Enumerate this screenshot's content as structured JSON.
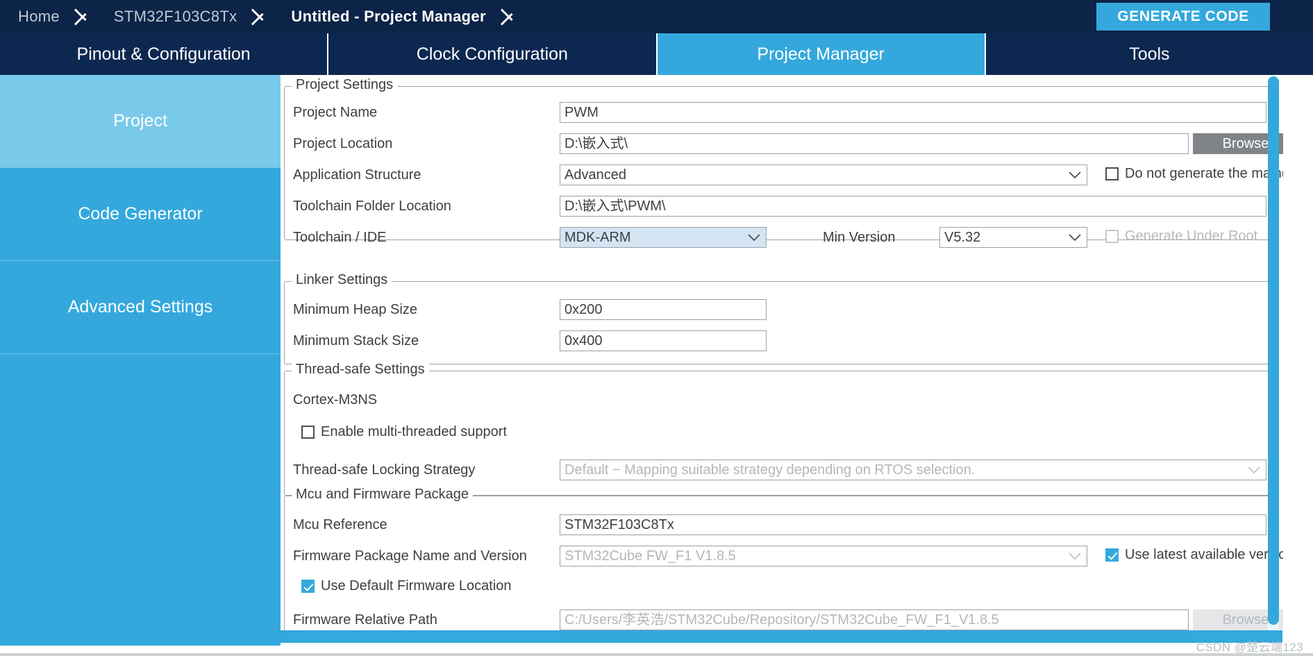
{
  "topbar": {
    "breadcrumbs": [
      {
        "label": "Home",
        "active": false
      },
      {
        "label": "STM32F103C8Tx",
        "active": false
      },
      {
        "label": "Untitled - Project Manager",
        "active": true
      }
    ],
    "generate_code_label": "GENERATE CODE",
    "accent_color": "#34a8dd",
    "bar_color": "#0b2447"
  },
  "tabs": [
    {
      "label": "Pinout & Configuration",
      "active": false
    },
    {
      "label": "Clock Configuration",
      "active": false
    },
    {
      "label": "Project Manager",
      "active": true
    },
    {
      "label": "Tools",
      "active": false
    }
  ],
  "sidebar": {
    "items": [
      {
        "label": "Project",
        "active": true
      },
      {
        "label": "Code Generator",
        "active": false
      },
      {
        "label": "Advanced Settings",
        "active": false
      }
    ]
  },
  "project_settings": {
    "legend": "Project Settings",
    "project_name": {
      "label": "Project Name",
      "value": "PWM"
    },
    "project_location": {
      "label": "Project Location",
      "value": "D:\\嵌入式\\",
      "browse_label": "Browse"
    },
    "application_structure": {
      "label": "Application Structure",
      "value": "Advanced"
    },
    "do_not_generate_main": {
      "label": "Do not generate the main()",
      "checked": false
    },
    "toolchain_folder_location": {
      "label": "Toolchain Folder Location",
      "value": "D:\\嵌入式\\PWM\\"
    },
    "toolchain_ide": {
      "label": "Toolchain / IDE",
      "value": "MDK-ARM"
    },
    "min_version": {
      "label": "Min Version",
      "value": "V5.32"
    },
    "generate_under_root": {
      "label": "Generate Under Root",
      "checked": false,
      "disabled": true
    }
  },
  "linker_settings": {
    "legend": "Linker Settings",
    "minimum_heap_size": {
      "label": "Minimum Heap Size",
      "value": "0x200"
    },
    "minimum_stack_size": {
      "label": "Minimum Stack Size",
      "value": "0x400"
    }
  },
  "thread_safe_settings": {
    "legend": "Thread-safe Settings",
    "core_label": "Cortex-M3NS",
    "enable_multithreaded": {
      "label": "Enable multi-threaded support",
      "checked": false
    },
    "locking_strategy": {
      "label": "Thread-safe Locking Strategy",
      "value": "Default  −  Mapping suitable strategy depending on RTOS selection."
    }
  },
  "mcu_firmware_package": {
    "legend": "Mcu and Firmware Package",
    "mcu_reference": {
      "label": "Mcu Reference",
      "value": "STM32F103C8Tx"
    },
    "firmware_package": {
      "label": "Firmware Package Name and Version",
      "value": "STM32Cube FW_F1 V1.8.5"
    },
    "use_latest_version": {
      "label": "Use latest available version",
      "checked": true
    },
    "use_default_firmware_location": {
      "label": "Use Default Firmware Location",
      "checked": true
    },
    "firmware_relative_path": {
      "label": "Firmware Relative Path",
      "value": "C:/Users/李英浩/STM32Cube/Repository/STM32Cube_FW_F1_V1.8.5",
      "browse_label": "Browse"
    }
  },
  "watermark": "CSDN @楚云端123"
}
